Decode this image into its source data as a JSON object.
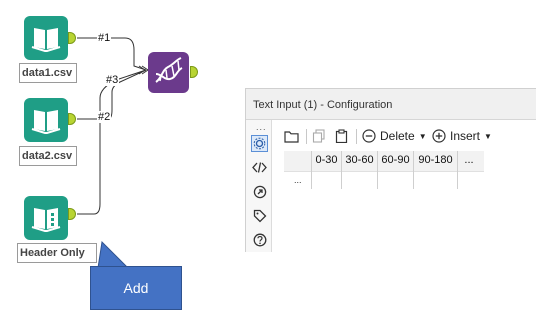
{
  "workflow": {
    "tools": [
      {
        "label": "data1.csv",
        "icon": "book-icon"
      },
      {
        "label": "data2.csv",
        "icon": "book-icon"
      },
      {
        "label": "Header Only",
        "icon": "text-input-book-icon"
      }
    ],
    "connections": [
      "#1",
      "#2",
      "#3"
    ],
    "join_tool_icon": "dna-icon",
    "colors": {
      "input_tool": "#1f9e86",
      "anchor": "#b8d432",
      "join_tool": "#6b3a8c",
      "callout": "#4472c4"
    }
  },
  "callout": {
    "text": "Add"
  },
  "config_panel": {
    "title": "Text Input (1) - Configuration",
    "side_icons": [
      "gear-icon",
      "code-icon",
      "arrow-circle-icon",
      "tag-icon",
      "help-icon"
    ],
    "side_dots": "...",
    "toolbar": {
      "delete_label": "Delete",
      "insert_label": "Insert"
    },
    "columns": [
      "0-30",
      "30-60",
      "60-90",
      "90-180",
      "..."
    ],
    "row_marker": "..."
  }
}
